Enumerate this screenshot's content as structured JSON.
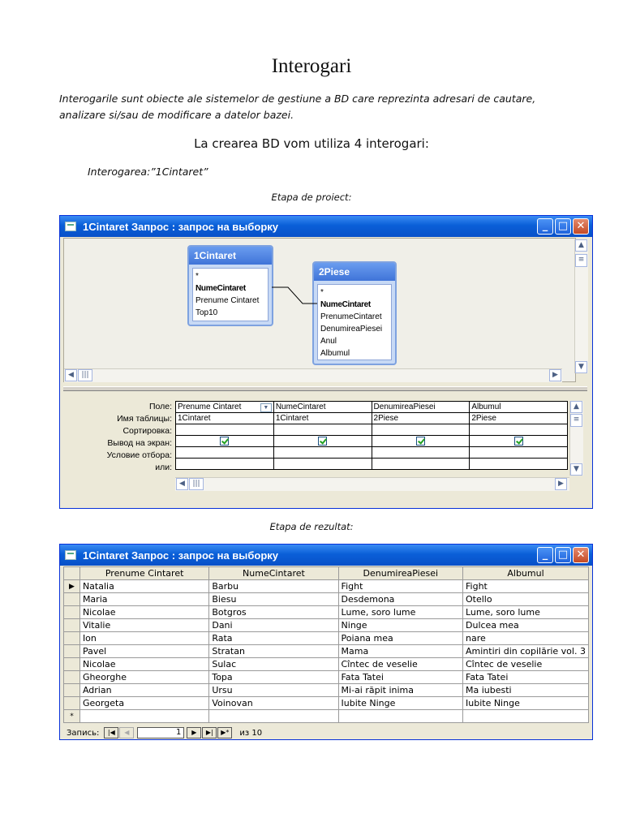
{
  "doc": {
    "title": "Interogari",
    "intro_line1": "Interogarile sunt obiecte ale sistemelor de gestiune a BD care reprezinta adresari de cautare,",
    "intro_line2": "analizare si/sau de modificare a datelor bazei.",
    "subhead": "La crearea BD vom utiliza 4 interogari:",
    "query_label": "Interogarea:”1Cintaret”",
    "caption_design": "Etapa de proiect:",
    "caption_result": "Etapa de rezultat:"
  },
  "design_window": {
    "title": "1Cintaret Запрос : запрос на выборку",
    "btn_min": "_",
    "btn_max": "□",
    "btn_close": "✕",
    "table1": {
      "name": "1Cintaret",
      "fields": [
        "*",
        "NumeCintaret",
        "Prenume Cintaret",
        "Top10"
      ]
    },
    "table2": {
      "name": "2Piese",
      "fields": [
        "*",
        "NumeCintaret",
        "PrenumeCintaret",
        "DenumireaPiesei",
        "Anul",
        "Albumul"
      ]
    },
    "row_labels": [
      "Поле:",
      "Имя таблицы:",
      "Сортировка:",
      "Вывод на экран:",
      "Условие отбора:",
      "или:"
    ],
    "fields": [
      "Prenume Cintaret",
      "NumeCintaret",
      "DenumireaPiesei",
      "Albumul"
    ],
    "tables": [
      "1Cintaret",
      "1Cintaret",
      "2Piese",
      "2Piese"
    ]
  },
  "result_window": {
    "title": "1Cintaret Запрос : запрос на выборку",
    "btn_min": "_",
    "btn_max": "□",
    "btn_close": "✕",
    "columns": [
      "Prenume Cintaret",
      "NumeCintaret",
      "DenumireaPiesei",
      "Albumul"
    ],
    "rows": [
      [
        "Natalia",
        "Barbu",
        "Fight",
        "Fight"
      ],
      [
        "Maria",
        "Biesu",
        "Desdemona",
        "Otello"
      ],
      [
        "Nicolae",
        "Botgros",
        "Lume, soro lume",
        "Lume, soro lume"
      ],
      [
        "Vitalie",
        "Dani",
        "Ninge",
        "Dulcea mea"
      ],
      [
        "Ion",
        "Rata",
        "Poiana mea",
        "nare"
      ],
      [
        "Pavel",
        "Stratan",
        "Mama",
        "Amintiri din copilărie vol. 3"
      ],
      [
        "Nicolae",
        "Sulac",
        "Cîntec de veselie",
        "Cîntec de veselie"
      ],
      [
        "Gheorghe",
        "Topa",
        "Fata Tatei",
        "Fata Tatei"
      ],
      [
        "Adrian",
        "Ursu",
        "Mi-ai răpit inima",
        "Ma iubesti"
      ],
      [
        "Georgeta",
        "Voinovan",
        "Iubite Ninge",
        "Iubite Ninge"
      ]
    ],
    "new_row_marker": "*",
    "current_marker": "▶",
    "nav": {
      "label": "Запись:",
      "current": "1",
      "of_text": "из 10"
    }
  }
}
